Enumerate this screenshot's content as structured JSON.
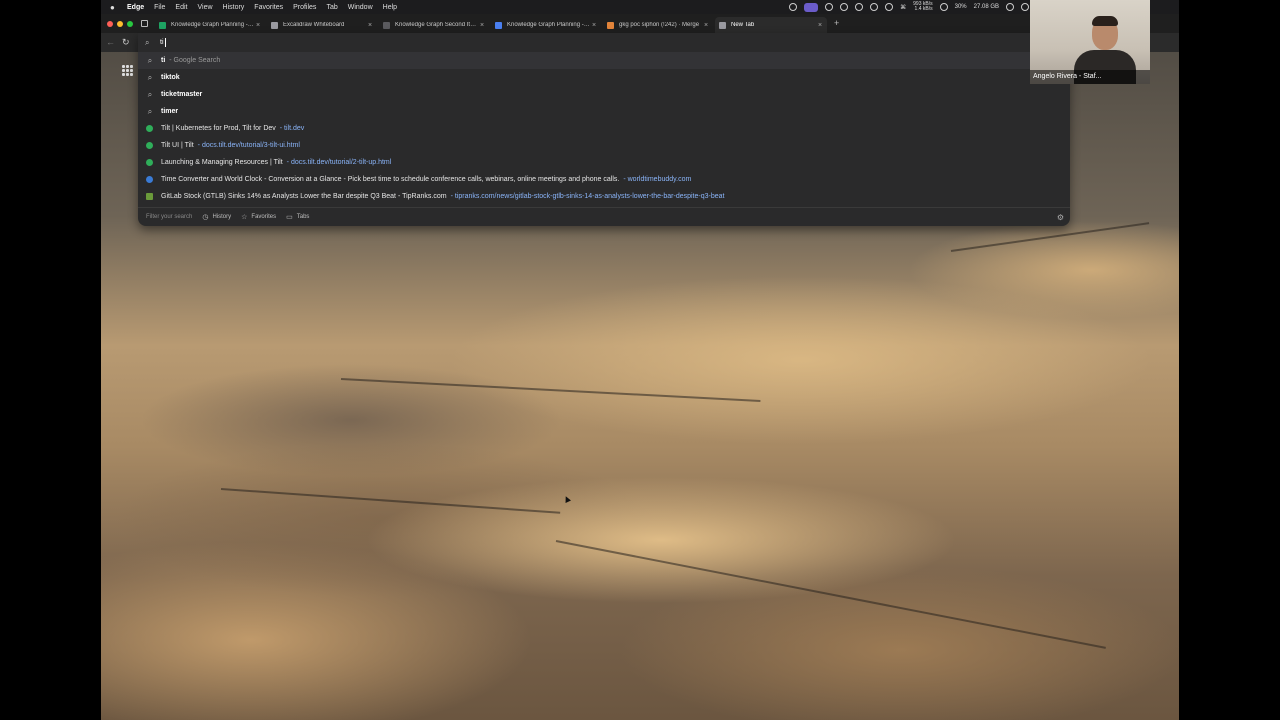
{
  "menubar": {
    "app": "Edge",
    "items": [
      "File",
      "Edit",
      "View",
      "History",
      "Favorites",
      "Profiles",
      "Tab",
      "Window",
      "Help"
    ],
    "net_up": "993 kB/s",
    "net_down": "1.4 kB/s",
    "battery": "30%",
    "storage": "27.08 GB"
  },
  "tabs": [
    {
      "title": "Knowledge Graph Planning - G",
      "favicon_color": "#1ea362"
    },
    {
      "title": "Excalidraw Whiteboard",
      "favicon_color": "#9a9aa0"
    },
    {
      "title": "Knowledge Graph Second Itera",
      "favicon_color": "#5a5a5e"
    },
    {
      "title": "Knowledge Graph Planning - G",
      "favicon_color": "#4a7ff0"
    },
    {
      "title": "gkg poc siphon (!242) · Merge",
      "favicon_color": "#e2843a"
    },
    {
      "title": "New Tab",
      "favicon_color": "#9a9aa0"
    }
  ],
  "omnibox": {
    "value": "ti"
  },
  "suggestions": [
    {
      "main_bold": "ti",
      "main_rest": "",
      "sub": "- Google Search",
      "kind": "search"
    },
    {
      "main_bold": "tiktok",
      "main_rest": "",
      "sub": "",
      "kind": "search"
    },
    {
      "main_bold": "ticketmaster",
      "main_rest": "",
      "sub": "",
      "kind": "search"
    },
    {
      "main_bold": "timer",
      "main_rest": "",
      "sub": "",
      "kind": "search"
    },
    {
      "main_bold": "",
      "main_rest": "Tilt | Kubernetes for Prod, Tilt for Dev",
      "sub": "- tilt.dev",
      "kind": "site"
    },
    {
      "main_bold": "",
      "main_rest": "Tilt UI | Tilt",
      "sub": "- docs.tilt.dev/tutorial/3-tilt-ui.html",
      "kind": "site"
    },
    {
      "main_bold": "",
      "main_rest": "Launching & Managing Resources | Tilt",
      "sub": "- docs.tilt.dev/tutorial/2-tilt-up.html",
      "kind": "site"
    },
    {
      "main_bold": "",
      "main_rest": "Time Converter and World Clock - Conversion at a Glance - Pick best time to schedule conference calls, webinars, online meetings and phone calls.",
      "sub": "- worldtimebuddy.com",
      "kind": "clock"
    },
    {
      "main_bold": "",
      "main_rest": "GitLab Stock (GTLB) Sinks 14% as Analysts Lower the Bar despite Q3 Beat - TipRanks.com",
      "sub": "- tipranks.com/news/gitlab-stock-gtlb-sinks-14-as-analysts-lower-the-bar-despite-q3-beat",
      "kind": "news"
    }
  ],
  "filterbar": {
    "placeholder": "Filter your search",
    "history": "History",
    "favorites": "Favorites",
    "tabs": "Tabs"
  },
  "webcam": {
    "name": "Angelo Rivera - Staf..."
  },
  "icons": {
    "search": "search-icon",
    "apps": "apps-grid-icon",
    "settings": "gear-icon"
  }
}
